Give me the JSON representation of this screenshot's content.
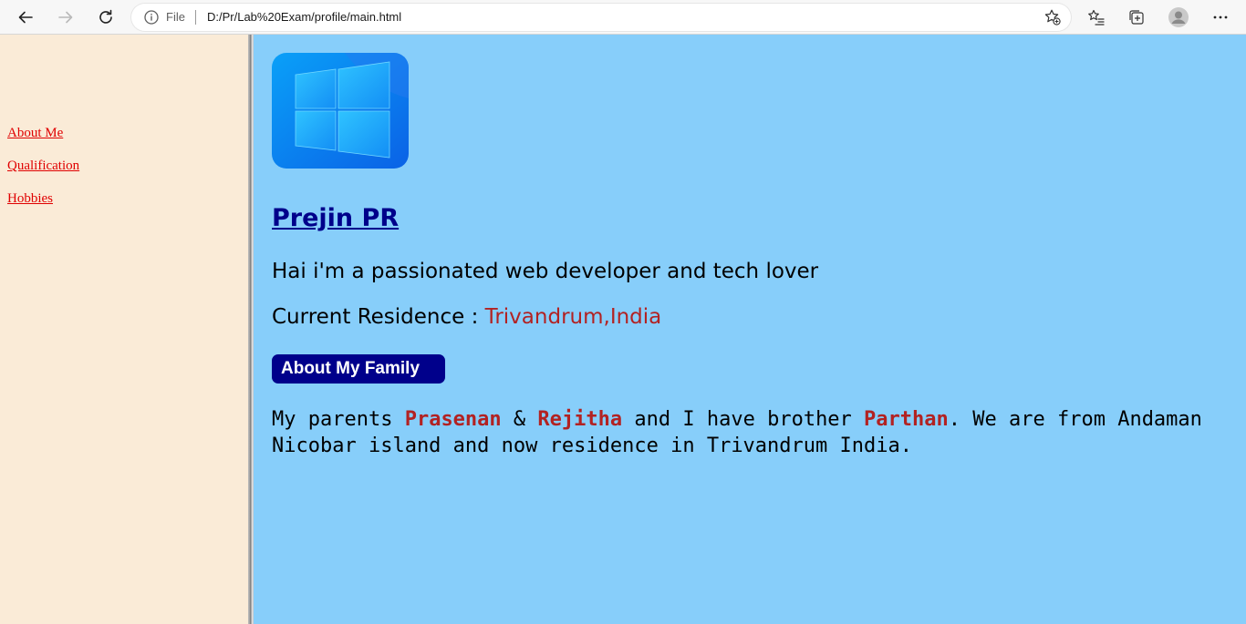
{
  "browser": {
    "file_label": "File",
    "url": "D:/Pr/Lab%20Exam/profile/main.html"
  },
  "sidebar": {
    "links": [
      {
        "label": "About Me"
      },
      {
        "label": "Qualification"
      },
      {
        "label": "Hobbies"
      }
    ]
  },
  "profile": {
    "name": "Prejin PR",
    "intro": "Hai i'm a passionated web developer and tech lover",
    "residence_label": "Current Residence : ",
    "residence_value": "Trivandrum,India",
    "family_heading": "About My Family",
    "family_text": {
      "t1": "My parents ",
      "parent1": "Prasenan",
      "t2": " & ",
      "parent2": "Rejitha",
      "t3": " and I have brother ",
      "brother": "Parthan",
      "t4": ". We are from Andaman Nicobar island and now residence in Trivandrum India."
    }
  },
  "colors": {
    "sidebar_bg": "#faebd7",
    "main_bg": "#87cefa",
    "link": "#e00000",
    "heading": "#00008b",
    "highlight": "#b22222"
  },
  "icons": {
    "back": "arrow-left-icon",
    "forward": "arrow-right-icon",
    "refresh": "refresh-icon",
    "info": "info-icon",
    "favorite": "star-plus-icon",
    "favorites": "favorites-list-icon",
    "collections": "collections-icon",
    "profile": "profile-avatar-icon",
    "menu": "more-menu-icon",
    "logo": "windows-logo"
  }
}
